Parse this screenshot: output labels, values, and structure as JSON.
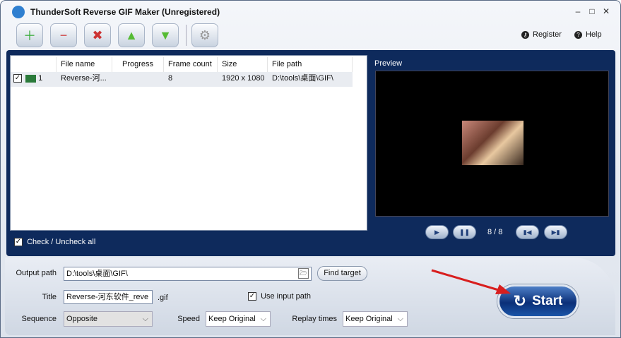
{
  "window": {
    "title": "ThunderSoft Reverse GIF Maker (Unregistered)"
  },
  "toolbar": {
    "register": "Register",
    "help": "Help"
  },
  "list": {
    "columns": [
      "File name",
      "Progress",
      "Frame count",
      "Size",
      "File path"
    ],
    "rows": [
      {
        "index": "1",
        "file_name": "Reverse-河...",
        "progress": "",
        "frame_count": "8",
        "size": "1920 x 1080",
        "file_path": "D:\\tools\\桌面\\GIF\\"
      }
    ],
    "check_all": "Check / Uncheck all"
  },
  "preview": {
    "label": "Preview",
    "frame": "8 / 8"
  },
  "output": {
    "path_label": "Output path",
    "path_value": "D:\\tools\\桌面\\GIF\\",
    "find_target": "Find target",
    "title_label": "Title",
    "title_value": "Reverse-河东软件_reve",
    "ext": ".gif",
    "use_input_path": "Use input path",
    "sequence_label": "Sequence",
    "sequence_value": "Opposite",
    "speed_label": "Speed",
    "speed_value": "Keep Original",
    "replay_label": "Replay times",
    "replay_value": "Keep Original"
  },
  "start": "Start"
}
